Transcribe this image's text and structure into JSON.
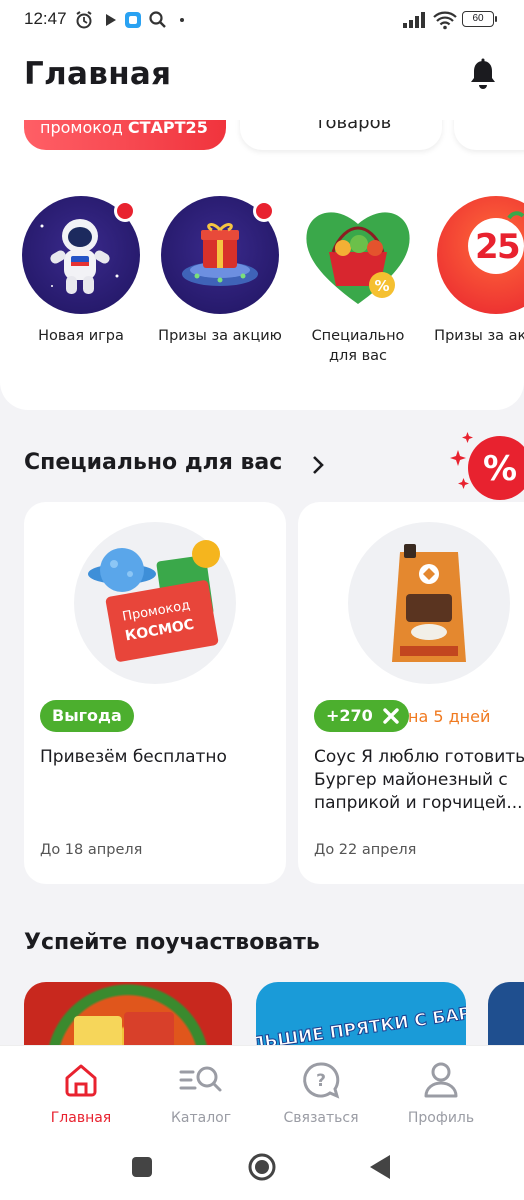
{
  "status_bar": {
    "time": "12:47",
    "battery": "60"
  },
  "header": {
    "title": "Главная"
  },
  "quick_links": {
    "promo_prefix": "промокод ",
    "promo_code": "СТАРТ25",
    "items_label": "товаров"
  },
  "stories": [
    {
      "label": "Новая игра",
      "icon": "astronaut-icon",
      "has_dot": true
    },
    {
      "label": "Призы за акцию",
      "icon": "gift-ufo-icon",
      "has_dot": true
    },
    {
      "label": "Специально для вас",
      "icon": "basket-heart-icon",
      "has_dot": false
    },
    {
      "label": "Призы за акцию",
      "icon": "25-years-icon",
      "has_dot": false
    }
  ],
  "special": {
    "title": "Специально для вас",
    "cards": [
      {
        "badge": "Выгода",
        "title": "Привезём бесплатно",
        "date": "До 18 апреля",
        "promo_text": "Промокод",
        "promo_code": "КОСМОС"
      },
      {
        "badge": "+270",
        "days": "на 5 дней",
        "title": "Соус Я люблю готовить Бургер майонезный с паприкой и горчицей...",
        "date": "До 22 апреля"
      }
    ]
  },
  "participate": {
    "title": "Успейте поучаствовать",
    "banner_text": "БОЛЬШИЕ ПРЯТКИ С БАРНИ"
  },
  "bottom_nav": [
    {
      "label": "Главная",
      "icon": "home-icon",
      "active": true
    },
    {
      "label": "Каталог",
      "icon": "catalog-search-icon",
      "active": false
    },
    {
      "label": "Связаться",
      "icon": "help-chat-icon",
      "active": false
    },
    {
      "label": "Профиль",
      "icon": "profile-icon",
      "active": false
    }
  ],
  "colors": {
    "accent": "#e8222f",
    "green": "#4caf2e",
    "orange": "#f07a20",
    "background": "#f3f3f6"
  }
}
